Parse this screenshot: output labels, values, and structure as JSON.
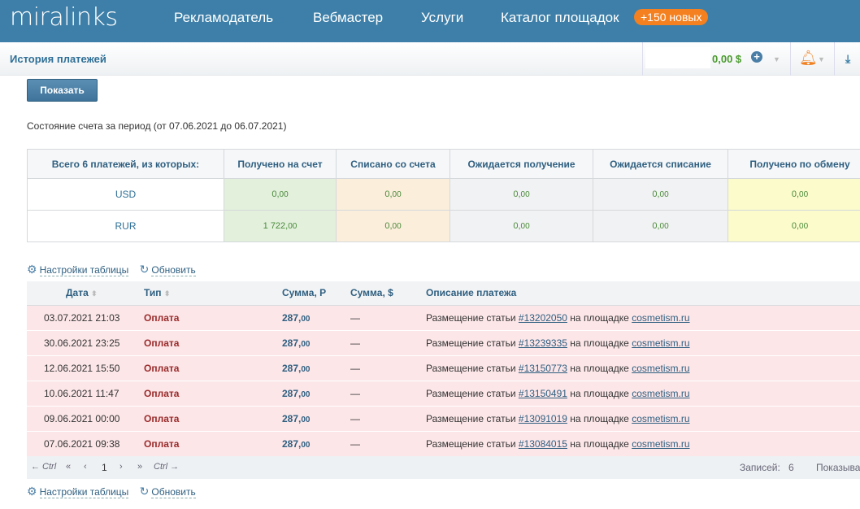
{
  "header": {
    "logo": "miralinks",
    "nav": [
      "Рекламодатель",
      "Вебмастер",
      "Услуги",
      "Каталог площадок"
    ],
    "badge": "+150 новых"
  },
  "subheader": {
    "title": "История платежей",
    "balance": "0,00 $"
  },
  "show_button": "Показать",
  "period": "Состояние счета за период (от 07.06.2021 до 06.07.2021)",
  "summary": {
    "headers": [
      "Всего 6 платежей, из которых:",
      "Получено на счет",
      "Списано со счета",
      "Ожидается получение",
      "Ожидается списание",
      "Получено по обмену"
    ],
    "rows": [
      {
        "label": "USD",
        "values": [
          [
            "0,",
            "00"
          ],
          [
            "0,",
            "00"
          ],
          [
            "0,",
            "00"
          ],
          [
            "0,",
            "00"
          ],
          [
            "0,",
            "00"
          ]
        ]
      },
      {
        "label": "RUR",
        "values": [
          [
            "1 722,",
            "00"
          ],
          [
            "0,",
            "00"
          ],
          [
            "0,",
            "00"
          ],
          [
            "0,",
            "00"
          ],
          [
            "0,",
            "00"
          ]
        ]
      }
    ]
  },
  "tools": {
    "settings": "Настройки таблицы",
    "refresh": "Обновить"
  },
  "table": {
    "headers": [
      "Дата",
      "Тип",
      "Сумма, Р",
      "Сумма, $",
      "Описание платежа"
    ],
    "rows": [
      {
        "date": "03.07.2021 21:03",
        "type": "Оплата",
        "rub": "287,",
        "rub_c": "00",
        "usd": "—",
        "desc": "Размещение статьи ",
        "num": "#13202050",
        "mid": " на площадке ",
        "site": "cosmetism.ru"
      },
      {
        "date": "30.06.2021 23:25",
        "type": "Оплата",
        "rub": "287,",
        "rub_c": "00",
        "usd": "—",
        "desc": "Размещение статьи ",
        "num": "#13239335",
        "mid": " на площадке ",
        "site": "cosmetism.ru"
      },
      {
        "date": "12.06.2021 15:50",
        "type": "Оплата",
        "rub": "287,",
        "rub_c": "00",
        "usd": "—",
        "desc": "Размещение статьи ",
        "num": "#13150773",
        "mid": " на площадке ",
        "site": "cosmetism.ru"
      },
      {
        "date": "10.06.2021 11:47",
        "type": "Оплата",
        "rub": "287,",
        "rub_c": "00",
        "usd": "—",
        "desc": "Размещение статьи ",
        "num": "#13150491",
        "mid": " на площадке ",
        "site": "cosmetism.ru"
      },
      {
        "date": "09.06.2021 00:00",
        "type": "Оплата",
        "rub": "287,",
        "rub_c": "00",
        "usd": "—",
        "desc": "Размещение статьи ",
        "num": "#13091019",
        "mid": " на площадке ",
        "site": "cosmetism.ru"
      },
      {
        "date": "07.06.2021 09:38",
        "type": "Оплата",
        "rub": "287,",
        "rub_c": "00",
        "usd": "—",
        "desc": "Размещение статьи ",
        "num": "#13084015",
        "mid": " на площадке ",
        "site": "cosmetism.ru"
      }
    ]
  },
  "pager": {
    "prev_ctrl": "← Ctrl",
    "first": "«",
    "prev": "‹",
    "page": "1",
    "next": "›",
    "last": "»",
    "next_ctrl": "Ctrl →",
    "records_label": "Записей:",
    "records": "6",
    "showing": "Показыва"
  }
}
